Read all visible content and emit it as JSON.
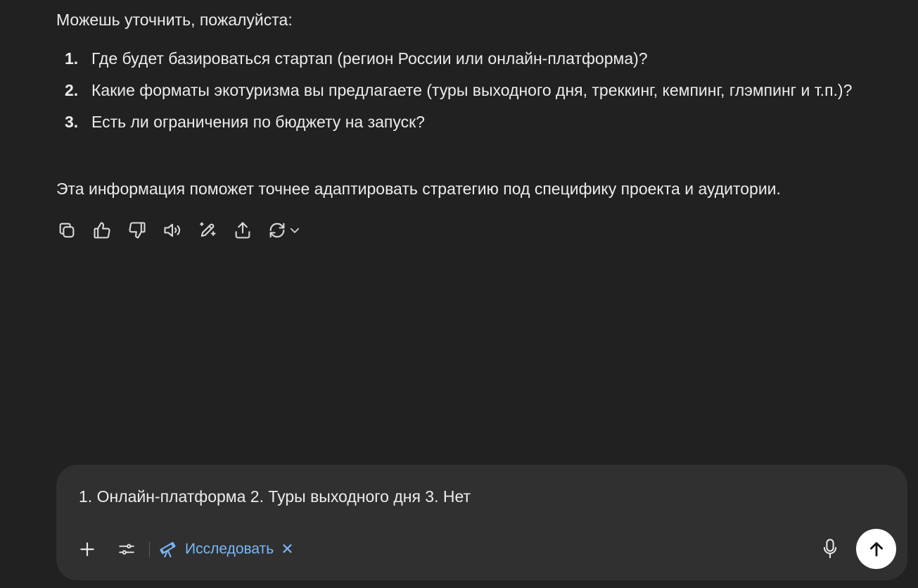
{
  "message": {
    "intro": "Можешь уточнить, пожалуйста:",
    "questions": [
      {
        "num": "1.",
        "text": "Где будет базироваться стартап (регион России или онлайн-платформа)?"
      },
      {
        "num": "2.",
        "text": "Какие форматы экотуризма вы предлагаете (туры выходного дня, треккинг, кемпинг, глэмпинг и т.п.)?"
      },
      {
        "num": "3.",
        "text": "Есть ли ограничения по бюджету на запуск?"
      }
    ],
    "outro": "Эта информация поможет точнее адаптировать стратегию под специфику проекта и аудитории."
  },
  "actions": {
    "icons": [
      "copy-icon",
      "thumbs-up-icon",
      "thumbs-down-icon",
      "read-aloud-icon",
      "edit-canvas-icon",
      "share-icon",
      "regenerate-icon",
      "chevron-down-icon"
    ]
  },
  "composer": {
    "input_value": "1. Онлайн-платформа 2. Туры выходного дня 3. Нет",
    "research_label": "Исследовать",
    "research_close": "✕",
    "accent_color": "#79b8f6",
    "icons": [
      "plus-icon",
      "tools-icon",
      "telescope-icon",
      "microphone-icon",
      "arrow-up-icon"
    ]
  }
}
